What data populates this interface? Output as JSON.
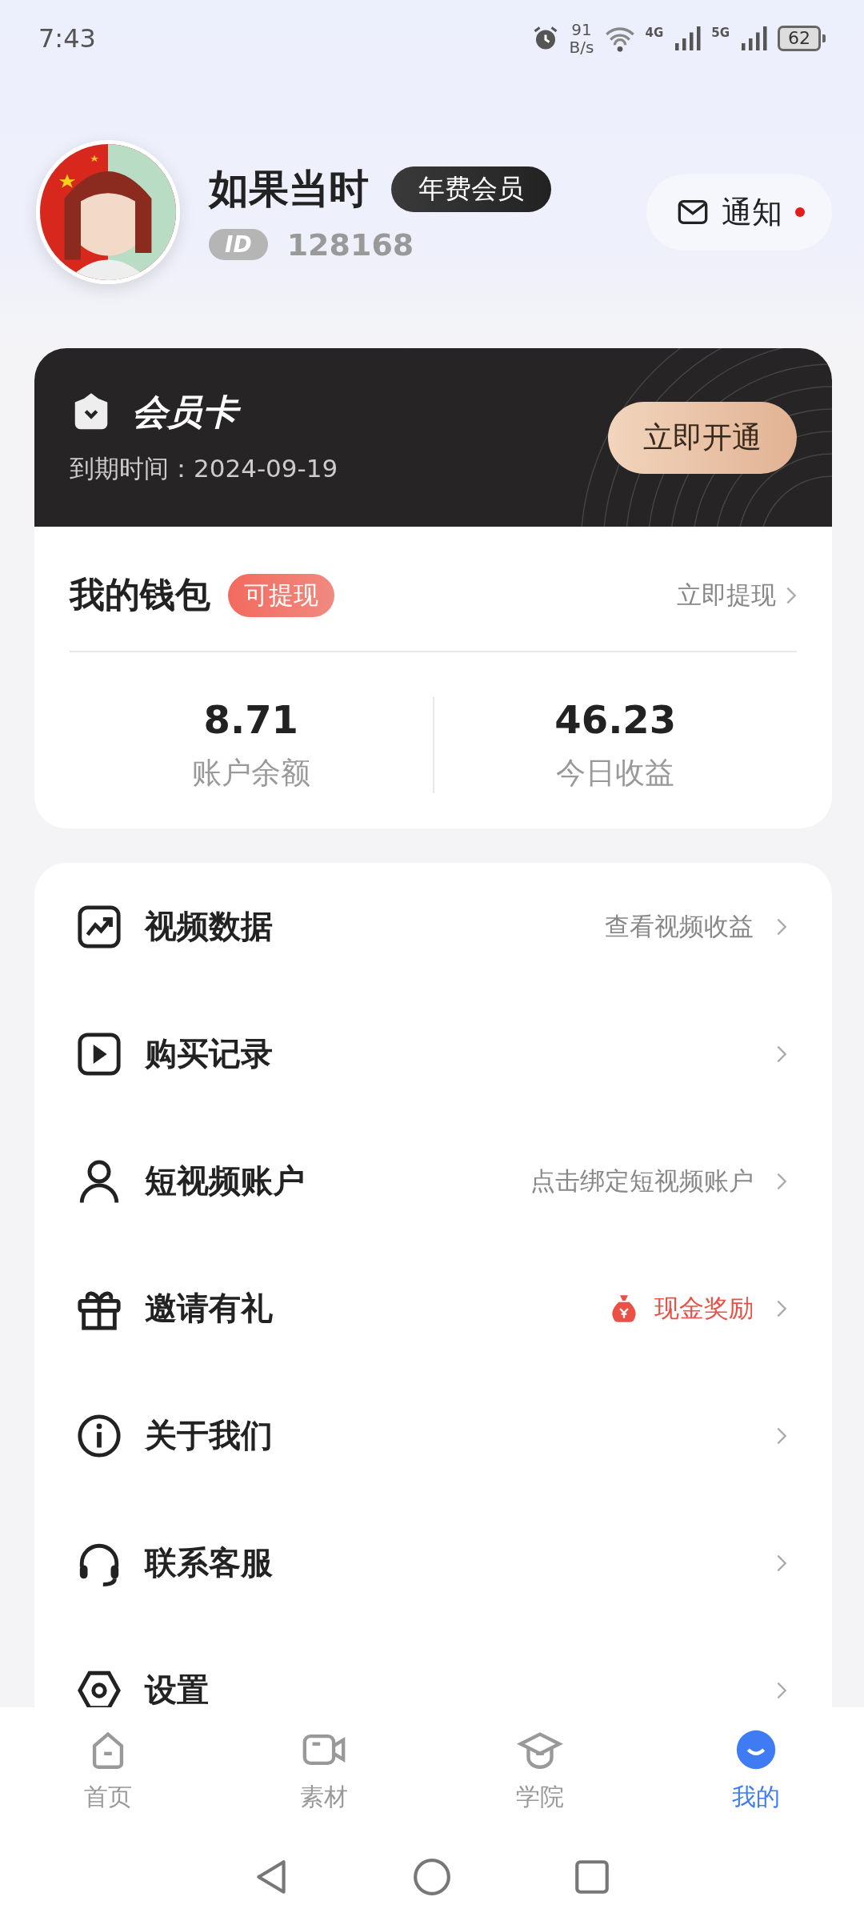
{
  "status_bar": {
    "time": "7:43",
    "speed_value": "91",
    "speed_unit": "B/s",
    "sim1": "4G",
    "sim2": "5G",
    "battery": "62"
  },
  "profile": {
    "name": "如果当时",
    "badge": "年费会员",
    "id_label": "ID",
    "id": "128168",
    "notify": {
      "label": "通知",
      "unread": true
    }
  },
  "member_card": {
    "title": "会员卡",
    "expiry": "到期时间：2024-09-19",
    "button": "立即开通"
  },
  "wallet": {
    "title": "我的钱包",
    "badge": "可提现",
    "action": "立即提现",
    "stats": [
      {
        "value": "8.71",
        "label": "账户余额"
      },
      {
        "value": "46.23",
        "label": "今日收益"
      }
    ]
  },
  "menu": [
    {
      "label": "视频数据",
      "hint": "查看视频收益",
      "kind": "plain"
    },
    {
      "label": "购买记录",
      "kind": "plain"
    },
    {
      "label": "短视频账户",
      "hint": "点击绑定短视频账户",
      "kind": "plain"
    },
    {
      "label": "邀请有礼",
      "hint": "现金奖励",
      "kind": "reward"
    },
    {
      "label": "关于我们",
      "kind": "plain"
    },
    {
      "label": "联系客服",
      "kind": "plain"
    },
    {
      "label": "设置",
      "kind": "plain"
    }
  ],
  "tabs": [
    {
      "label": "首页",
      "selected": false
    },
    {
      "label": "素材",
      "selected": false
    },
    {
      "label": "学院",
      "selected": false
    },
    {
      "label": "我的",
      "selected": true
    }
  ]
}
